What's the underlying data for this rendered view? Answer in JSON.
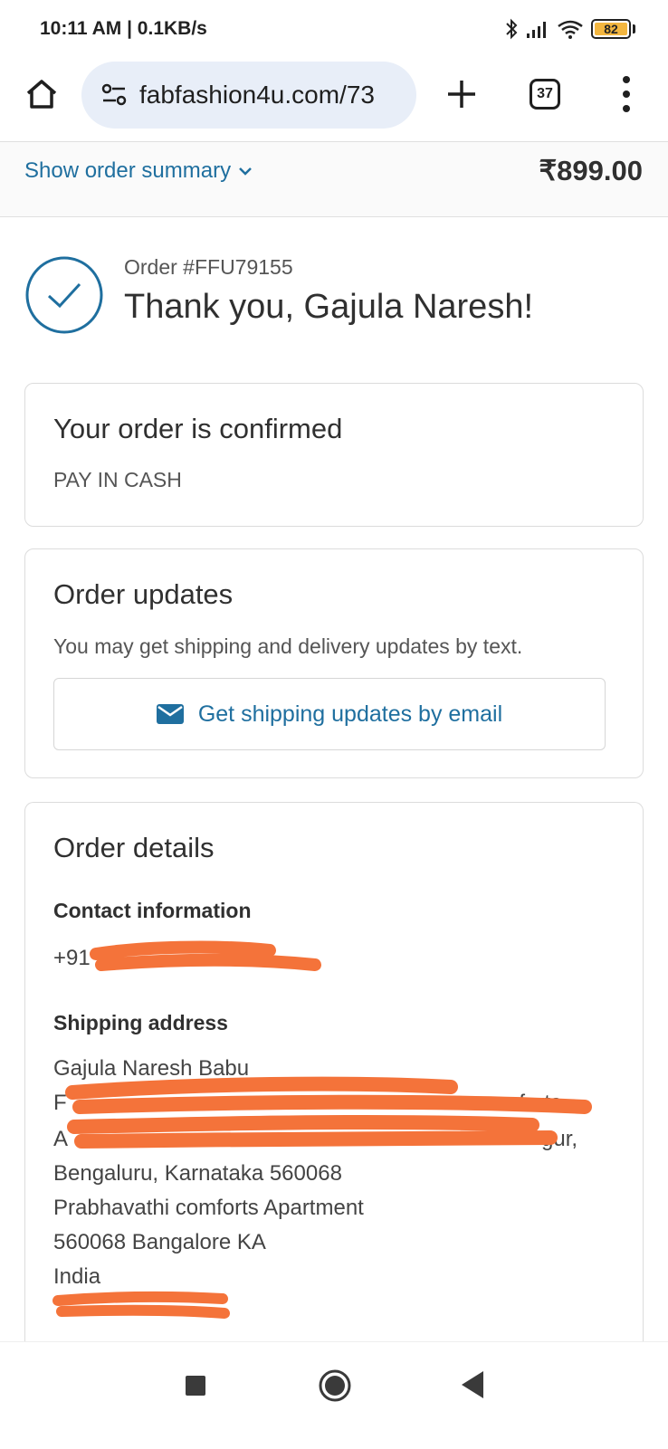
{
  "status_bar": {
    "time_speed": "10:11 AM | 0.1KB/s",
    "battery": "82",
    "icons": [
      "bluetooth-icon",
      "signal-icon",
      "wifi-icon",
      "battery-icon"
    ]
  },
  "browser": {
    "url": "fabfashion4u.com/73",
    "tab_count": "37",
    "icons": [
      "home-icon",
      "site-settings-icon",
      "new-tab-icon",
      "tab-switcher-icon",
      "more-menu-icon"
    ]
  },
  "summary": {
    "toggle_label": "Show order summary",
    "total": "₹899.00"
  },
  "confirmation": {
    "order_number": "Order #FFU79155",
    "thank_you": "Thank you, Gajula Naresh!"
  },
  "confirmed_card": {
    "title": "Your order is confirmed",
    "payment": "PAY IN CASH"
  },
  "updates_card": {
    "title": "Order updates",
    "text": "You may get shipping and delivery updates by text.",
    "email_button": "Get shipping updates by email"
  },
  "details_card": {
    "title": "Order details",
    "contact_label": "Contact information",
    "contact_visible": "+91",
    "shipping_label": "Shipping address",
    "address_name": "Gajula Naresh Babu",
    "address_partial_1": "F",
    "address_partial_1_tail": "comforts",
    "address_partial_2": "A",
    "address_partial_2_tail": "gur,",
    "address_city": "Bengaluru, Karnataka 560068",
    "address_line_apartment": "Prabhavathi comforts Apartment",
    "address_line_pin": "560068 Bangalore KA",
    "address_country": "India"
  },
  "colors": {
    "accent": "#1f6f9f",
    "redaction": "#f4733a",
    "battery": "#f3b63f"
  }
}
